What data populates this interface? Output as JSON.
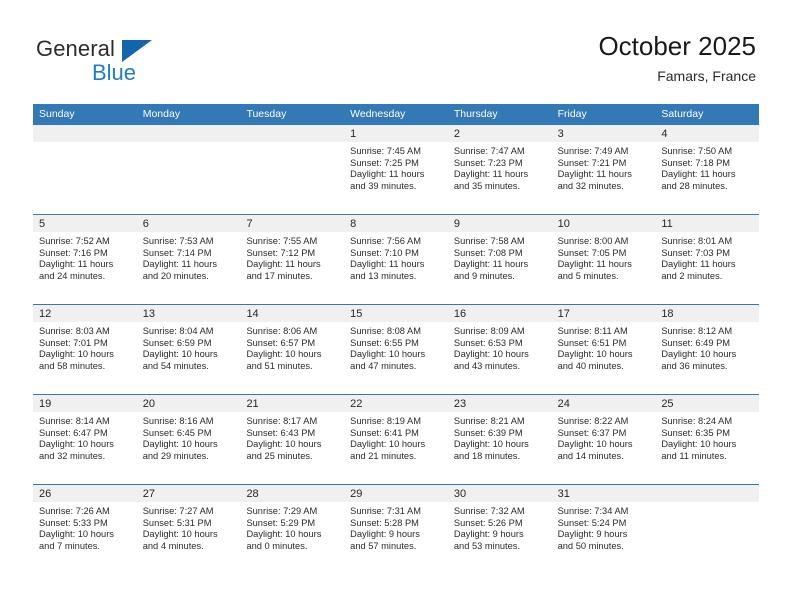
{
  "logo": {
    "word_top": "General",
    "word_bottom": "Blue",
    "triangle_color": "#1265ad",
    "blue_color": "#1f7ec4"
  },
  "header": {
    "title": "October 2025",
    "subtitle": "Famars, France"
  },
  "theme": {
    "header_blue": "#3279b5",
    "day_band_gray": "#f0f0f0",
    "text_color": "#2b2b2b"
  },
  "weekdays": [
    "Sunday",
    "Monday",
    "Tuesday",
    "Wednesday",
    "Thursday",
    "Friday",
    "Saturday"
  ],
  "labels": {
    "sunrise": "Sunrise:",
    "sunset": "Sunset:",
    "daylight": "Daylight:"
  },
  "weeks": [
    [
      {
        "day": "",
        "lines": []
      },
      {
        "day": "",
        "lines": []
      },
      {
        "day": "",
        "lines": []
      },
      {
        "day": "1",
        "lines": [
          "Sunrise: 7:45 AM",
          "Sunset: 7:25 PM",
          "Daylight: 11 hours",
          "and 39 minutes."
        ]
      },
      {
        "day": "2",
        "lines": [
          "Sunrise: 7:47 AM",
          "Sunset: 7:23 PM",
          "Daylight: 11 hours",
          "and 35 minutes."
        ]
      },
      {
        "day": "3",
        "lines": [
          "Sunrise: 7:49 AM",
          "Sunset: 7:21 PM",
          "Daylight: 11 hours",
          "and 32 minutes."
        ]
      },
      {
        "day": "4",
        "lines": [
          "Sunrise: 7:50 AM",
          "Sunset: 7:18 PM",
          "Daylight: 11 hours",
          "and 28 minutes."
        ]
      }
    ],
    [
      {
        "day": "5",
        "lines": [
          "Sunrise: 7:52 AM",
          "Sunset: 7:16 PM",
          "Daylight: 11 hours",
          "and 24 minutes."
        ]
      },
      {
        "day": "6",
        "lines": [
          "Sunrise: 7:53 AM",
          "Sunset: 7:14 PM",
          "Daylight: 11 hours",
          "and 20 minutes."
        ]
      },
      {
        "day": "7",
        "lines": [
          "Sunrise: 7:55 AM",
          "Sunset: 7:12 PM",
          "Daylight: 11 hours",
          "and 17 minutes."
        ]
      },
      {
        "day": "8",
        "lines": [
          "Sunrise: 7:56 AM",
          "Sunset: 7:10 PM",
          "Daylight: 11 hours",
          "and 13 minutes."
        ]
      },
      {
        "day": "9",
        "lines": [
          "Sunrise: 7:58 AM",
          "Sunset: 7:08 PM",
          "Daylight: 11 hours",
          "and 9 minutes."
        ]
      },
      {
        "day": "10",
        "lines": [
          "Sunrise: 8:00 AM",
          "Sunset: 7:05 PM",
          "Daylight: 11 hours",
          "and 5 minutes."
        ]
      },
      {
        "day": "11",
        "lines": [
          "Sunrise: 8:01 AM",
          "Sunset: 7:03 PM",
          "Daylight: 11 hours",
          "and 2 minutes."
        ]
      }
    ],
    [
      {
        "day": "12",
        "lines": [
          "Sunrise: 8:03 AM",
          "Sunset: 7:01 PM",
          "Daylight: 10 hours",
          "and 58 minutes."
        ]
      },
      {
        "day": "13",
        "lines": [
          "Sunrise: 8:04 AM",
          "Sunset: 6:59 PM",
          "Daylight: 10 hours",
          "and 54 minutes."
        ]
      },
      {
        "day": "14",
        "lines": [
          "Sunrise: 8:06 AM",
          "Sunset: 6:57 PM",
          "Daylight: 10 hours",
          "and 51 minutes."
        ]
      },
      {
        "day": "15",
        "lines": [
          "Sunrise: 8:08 AM",
          "Sunset: 6:55 PM",
          "Daylight: 10 hours",
          "and 47 minutes."
        ]
      },
      {
        "day": "16",
        "lines": [
          "Sunrise: 8:09 AM",
          "Sunset: 6:53 PM",
          "Daylight: 10 hours",
          "and 43 minutes."
        ]
      },
      {
        "day": "17",
        "lines": [
          "Sunrise: 8:11 AM",
          "Sunset: 6:51 PM",
          "Daylight: 10 hours",
          "and 40 minutes."
        ]
      },
      {
        "day": "18",
        "lines": [
          "Sunrise: 8:12 AM",
          "Sunset: 6:49 PM",
          "Daylight: 10 hours",
          "and 36 minutes."
        ]
      }
    ],
    [
      {
        "day": "19",
        "lines": [
          "Sunrise: 8:14 AM",
          "Sunset: 6:47 PM",
          "Daylight: 10 hours",
          "and 32 minutes."
        ]
      },
      {
        "day": "20",
        "lines": [
          "Sunrise: 8:16 AM",
          "Sunset: 6:45 PM",
          "Daylight: 10 hours",
          "and 29 minutes."
        ]
      },
      {
        "day": "21",
        "lines": [
          "Sunrise: 8:17 AM",
          "Sunset: 6:43 PM",
          "Daylight: 10 hours",
          "and 25 minutes."
        ]
      },
      {
        "day": "22",
        "lines": [
          "Sunrise: 8:19 AM",
          "Sunset: 6:41 PM",
          "Daylight: 10 hours",
          "and 21 minutes."
        ]
      },
      {
        "day": "23",
        "lines": [
          "Sunrise: 8:21 AM",
          "Sunset: 6:39 PM",
          "Daylight: 10 hours",
          "and 18 minutes."
        ]
      },
      {
        "day": "24",
        "lines": [
          "Sunrise: 8:22 AM",
          "Sunset: 6:37 PM",
          "Daylight: 10 hours",
          "and 14 minutes."
        ]
      },
      {
        "day": "25",
        "lines": [
          "Sunrise: 8:24 AM",
          "Sunset: 6:35 PM",
          "Daylight: 10 hours",
          "and 11 minutes."
        ]
      }
    ],
    [
      {
        "day": "26",
        "lines": [
          "Sunrise: 7:26 AM",
          "Sunset: 5:33 PM",
          "Daylight: 10 hours",
          "and 7 minutes."
        ]
      },
      {
        "day": "27",
        "lines": [
          "Sunrise: 7:27 AM",
          "Sunset: 5:31 PM",
          "Daylight: 10 hours",
          "and 4 minutes."
        ]
      },
      {
        "day": "28",
        "lines": [
          "Sunrise: 7:29 AM",
          "Sunset: 5:29 PM",
          "Daylight: 10 hours",
          "and 0 minutes."
        ]
      },
      {
        "day": "29",
        "lines": [
          "Sunrise: 7:31 AM",
          "Sunset: 5:28 PM",
          "Daylight: 9 hours",
          "and 57 minutes."
        ]
      },
      {
        "day": "30",
        "lines": [
          "Sunrise: 7:32 AM",
          "Sunset: 5:26 PM",
          "Daylight: 9 hours",
          "and 53 minutes."
        ]
      },
      {
        "day": "31",
        "lines": [
          "Sunrise: 7:34 AM",
          "Sunset: 5:24 PM",
          "Daylight: 9 hours",
          "and 50 minutes."
        ]
      },
      {
        "day": "",
        "lines": []
      }
    ]
  ]
}
